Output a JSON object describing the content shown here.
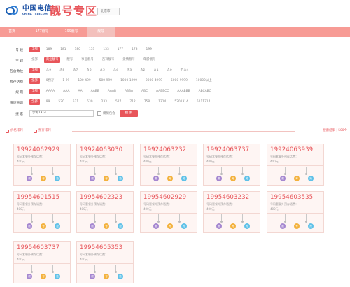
{
  "header": {
    "logo_cn": "中国电信",
    "logo_en": "CHINA TELECOM",
    "title": "靓号专区",
    "region_select": "北京市"
  },
  "nav": [
    "首页",
    "177靓号",
    "199靓号",
    "靓号"
  ],
  "filters": [
    {
      "label": "号 段：",
      "options": [
        "全部",
        "189",
        "181",
        "180",
        "153",
        "133",
        "177",
        "173",
        "199"
      ],
      "selected": 0
    },
    {
      "label": "主 题：",
      "options": [
        "全部",
        "商业靓号",
        "靓号",
        "事业靓号",
        "吉祥靓号",
        "爱情靓号",
        "年龄靓号"
      ],
      "selected": 1
    },
    {
      "label": "包含数位：",
      "options": [
        "全部",
        "含9",
        "含8",
        "含7",
        "含6",
        "含5",
        "含4",
        "含3",
        "含2",
        "含1",
        "含0",
        "不含4"
      ],
      "selected": 0
    },
    {
      "label": "预存话费：",
      "options": [
        "全部",
        "0预存",
        "1-99",
        "100-499",
        "500-999",
        "1000-1999",
        "2000-4999",
        "5000-9999",
        "10000以上"
      ],
      "selected": 0
    },
    {
      "label": "规 则：",
      "options": [
        "全部",
        "AAAA",
        "AAA",
        "AA",
        "AABB",
        "AAAB",
        "ABBA",
        "ABC",
        "AABBCC",
        "AAABBB",
        "ABCABC"
      ],
      "selected": 0
    },
    {
      "label": "快速查询：",
      "options": [
        "全部",
        "99",
        "520",
        "521",
        "530",
        "233",
        "527",
        "712",
        "758",
        "1314",
        "5201314",
        "5211314"
      ],
      "selected": 0
    }
  ],
  "search": {
    "label": "搜 索：",
    "value": "示例1314",
    "checkbox_label": "模糊包含",
    "button": "搜 索"
  },
  "sort": {
    "price": "价格排列",
    "prestore": "预存排列",
    "result_count": "搜索结果 | 500个"
  },
  "cards": [
    {
      "number": "19924062929",
      "desc": "号码套餐外预存话费：",
      "price": "400元"
    },
    {
      "number": "19924063030",
      "desc": "号码套餐外预存话费：",
      "price": "400元"
    },
    {
      "number": "19924063232",
      "desc": "号码套餐外预存话费：",
      "price": "400元"
    },
    {
      "number": "19924063737",
      "desc": "号码套餐外预存话费：",
      "price": "400元"
    },
    {
      "number": "19924063939",
      "desc": "号码套餐外预存话费：",
      "price": "400元"
    },
    {
      "number": "19954601515",
      "desc": "号码套餐外预存话费：",
      "price": "400元"
    },
    {
      "number": "19954602323",
      "desc": "号码套餐外预存话费：",
      "price": "400元"
    },
    {
      "number": "19954602929",
      "desc": "号码套餐外预存话费：",
      "price": "400元"
    },
    {
      "number": "19954603232",
      "desc": "号码套餐外预存话费：",
      "price": "400元"
    },
    {
      "number": "19954603535",
      "desc": "号码套餐外预存话费：",
      "price": "400元"
    },
    {
      "number": "19954603737",
      "desc": "号码套餐外预存话费：",
      "price": "400元"
    },
    {
      "number": "19954605353",
      "desc": "号码套餐外预存话费：",
      "price": "400元"
    }
  ],
  "card_buttons": [
    "靓",
    "号",
    "抢"
  ],
  "colors": {
    "accent": "#e8555a",
    "nav": "#f79b95",
    "card_bg": "#fef5f3"
  }
}
